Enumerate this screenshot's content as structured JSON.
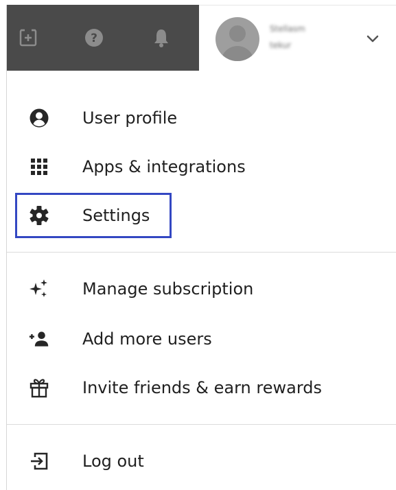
{
  "header": {
    "toolbar_icons": [
      "add-task-icon",
      "help-icon",
      "bell-icon"
    ],
    "user": {
      "name": "Stellasm",
      "subtitle": "tekur",
      "avatar": "avatar-placeholder"
    },
    "dropdown_icon": "chevron-down-icon"
  },
  "menu": {
    "group1": [
      {
        "label": "User profile",
        "icon": "user-circle-icon"
      },
      {
        "label": "Apps & integrations",
        "icon": "grid-icon"
      },
      {
        "label": "Settings",
        "icon": "gear-icon"
      }
    ],
    "group2": [
      {
        "label": "Manage subscription",
        "icon": "sparkles-icon"
      },
      {
        "label": "Add more users",
        "icon": "add-user-icon"
      },
      {
        "label": "Invite friends & earn rewards",
        "icon": "gift-icon"
      }
    ],
    "group3": [
      {
        "label": "Log out",
        "icon": "logout-icon"
      }
    ]
  },
  "colors": {
    "toolbar_bg": "#4a4a4a",
    "toolbar_icon": "#8c8c8c",
    "highlight": "#3347c2",
    "text": "#1f1f1f"
  }
}
